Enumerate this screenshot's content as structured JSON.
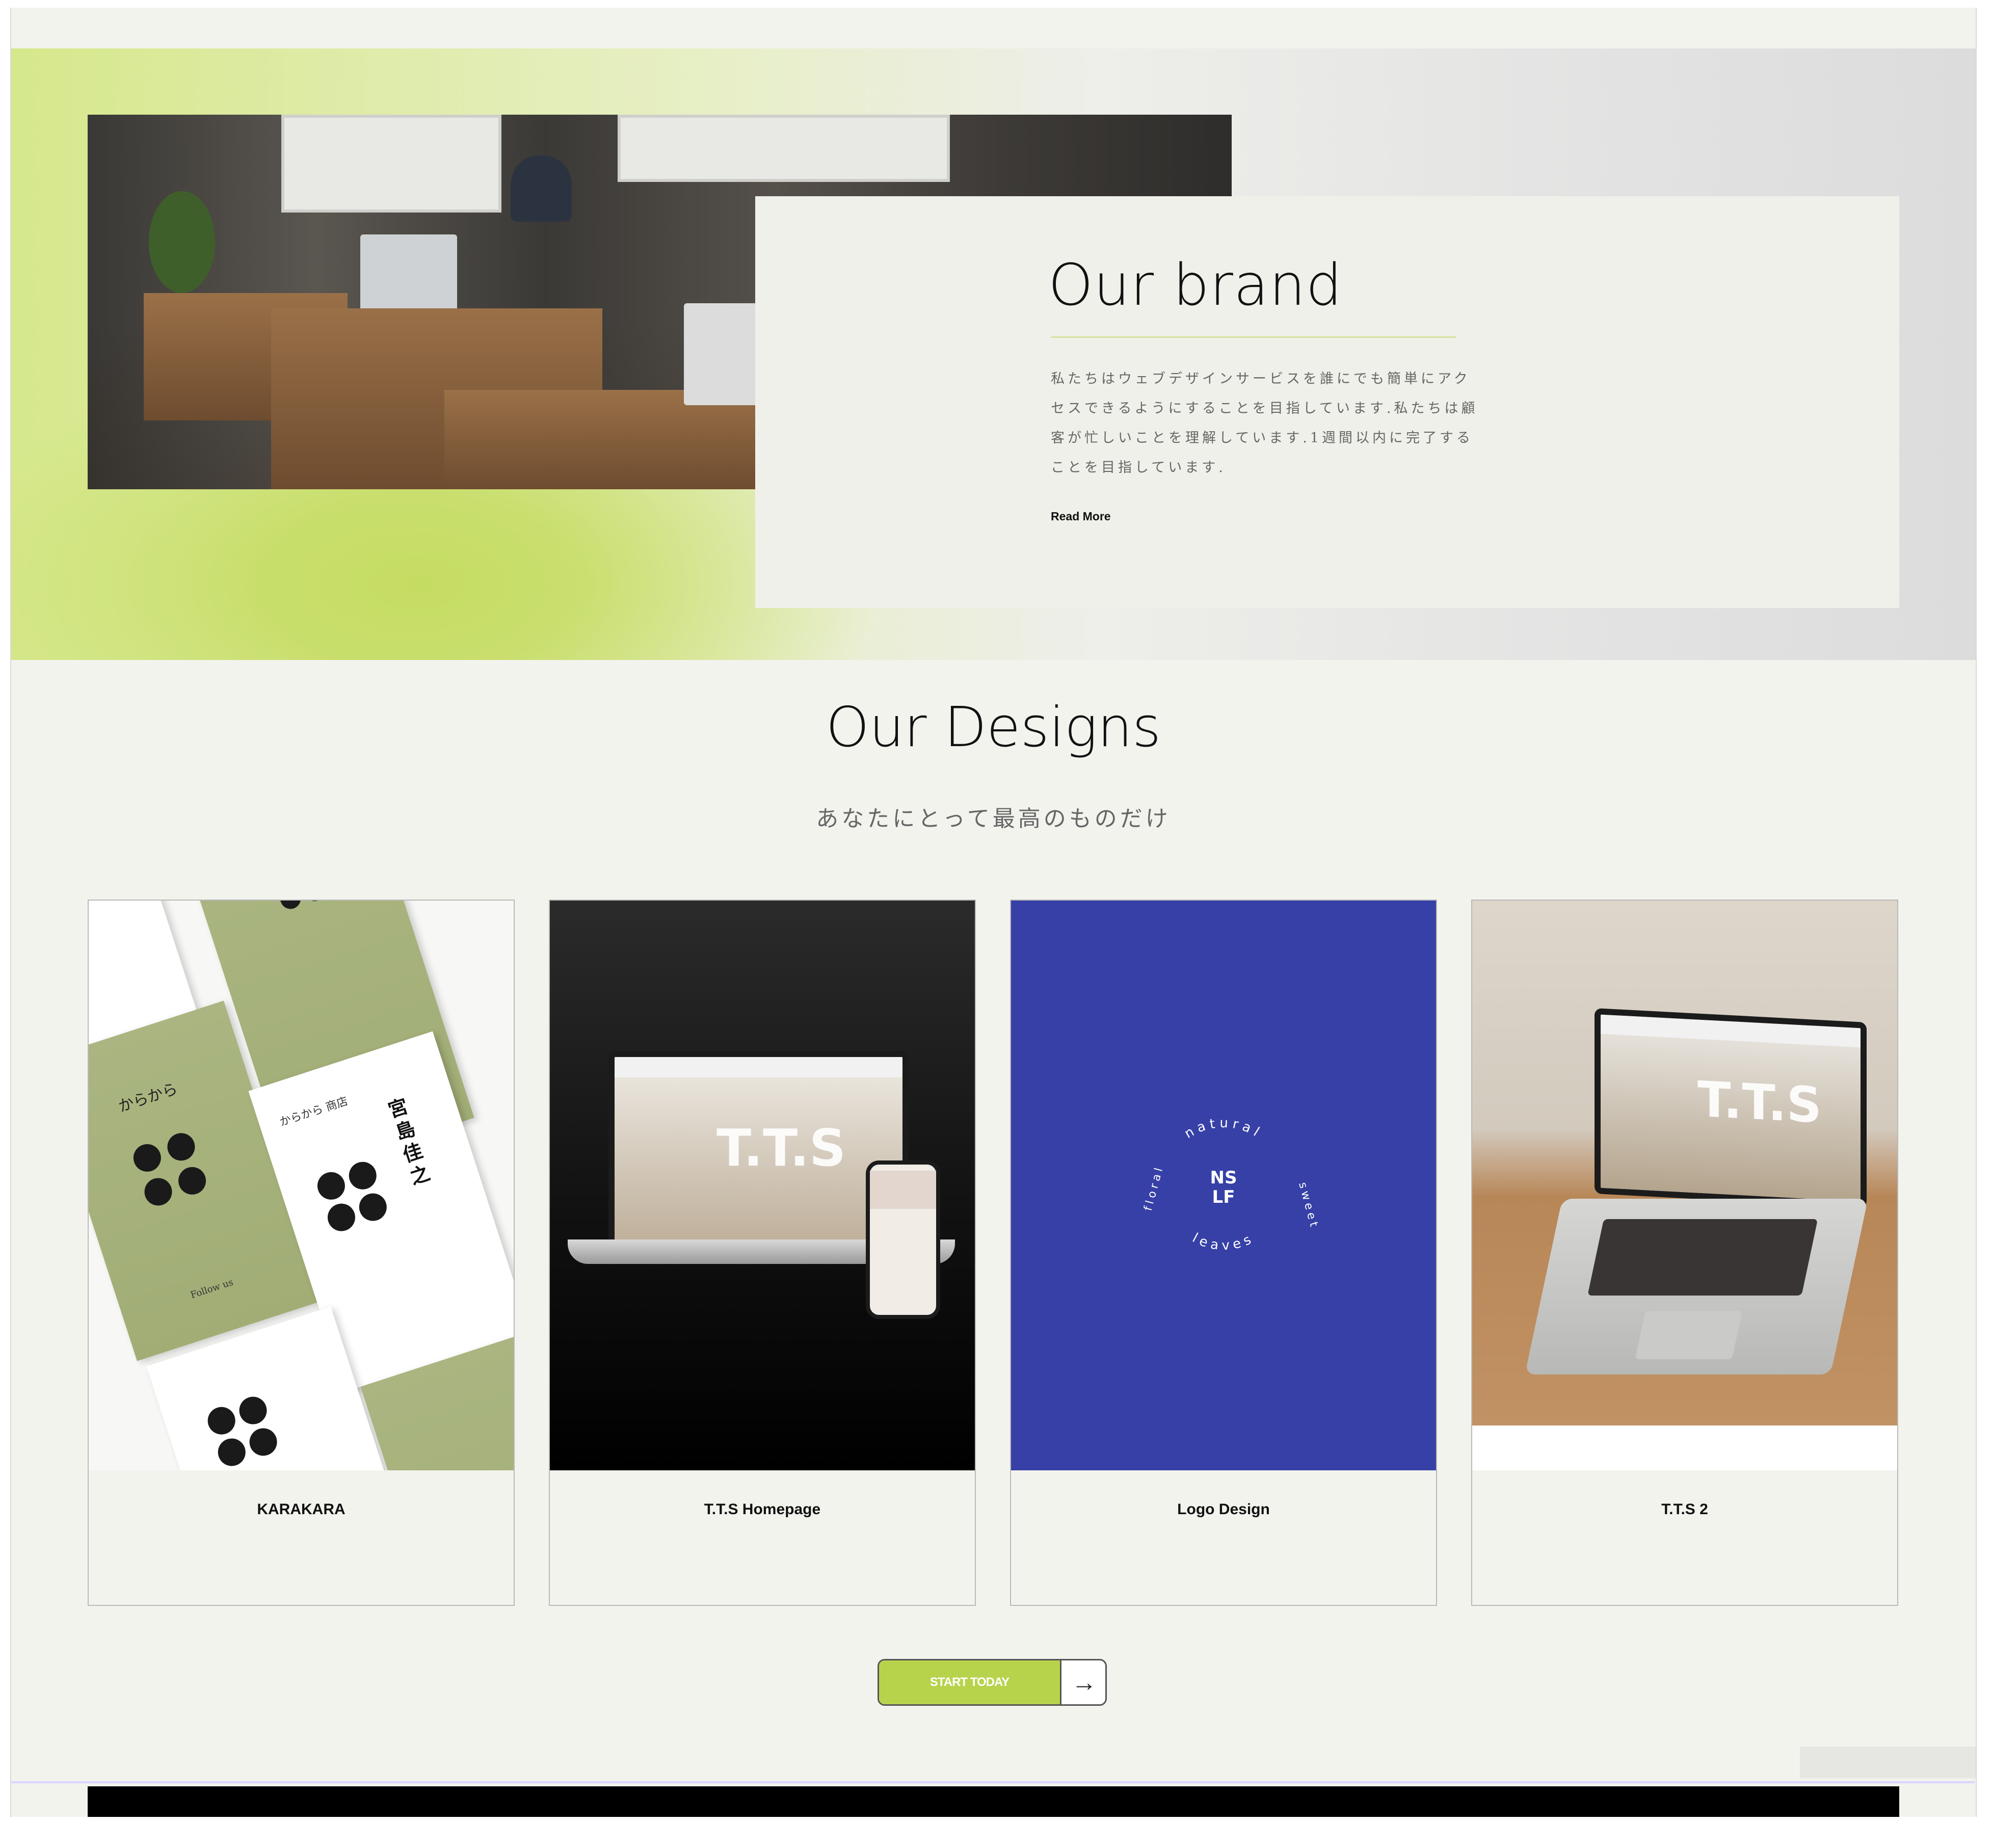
{
  "brand": {
    "title": "Our brand",
    "text": "私たちはウェブデザインサービスを誰にでも簡単にアクセスできるようにすることを目指しています.私たちは顧客が忙しいことを理解しています.1週間以内に完了することを目指しています.",
    "read_more": "Read More"
  },
  "designs": {
    "title": "Our Designs",
    "subtitle": "あなたにとって最高のものだけ",
    "cards": [
      {
        "label": "KARAKARA"
      },
      {
        "label": "T.T.S Homepage"
      },
      {
        "label": "Logo Design"
      },
      {
        "label": "T.T.S 2"
      }
    ]
  },
  "card_art": {
    "karakara": {
      "card_title": "からから",
      "name": "宮島 佳之",
      "follow": "Follow us",
      "company": "からから 商店"
    },
    "tts": {
      "logo": "T.T.S"
    },
    "logo": {
      "center_top": "NS",
      "center_bottom": "LF",
      "ring_words": [
        "natural",
        "sweet",
        "leaves",
        "floral"
      ]
    }
  },
  "cta": {
    "label": "START TODAY",
    "arrow": "→"
  },
  "colors": {
    "accent_green": "#b7d34c",
    "page_bg": "#f3f3ee",
    "logo_blue": "#3640a6"
  }
}
